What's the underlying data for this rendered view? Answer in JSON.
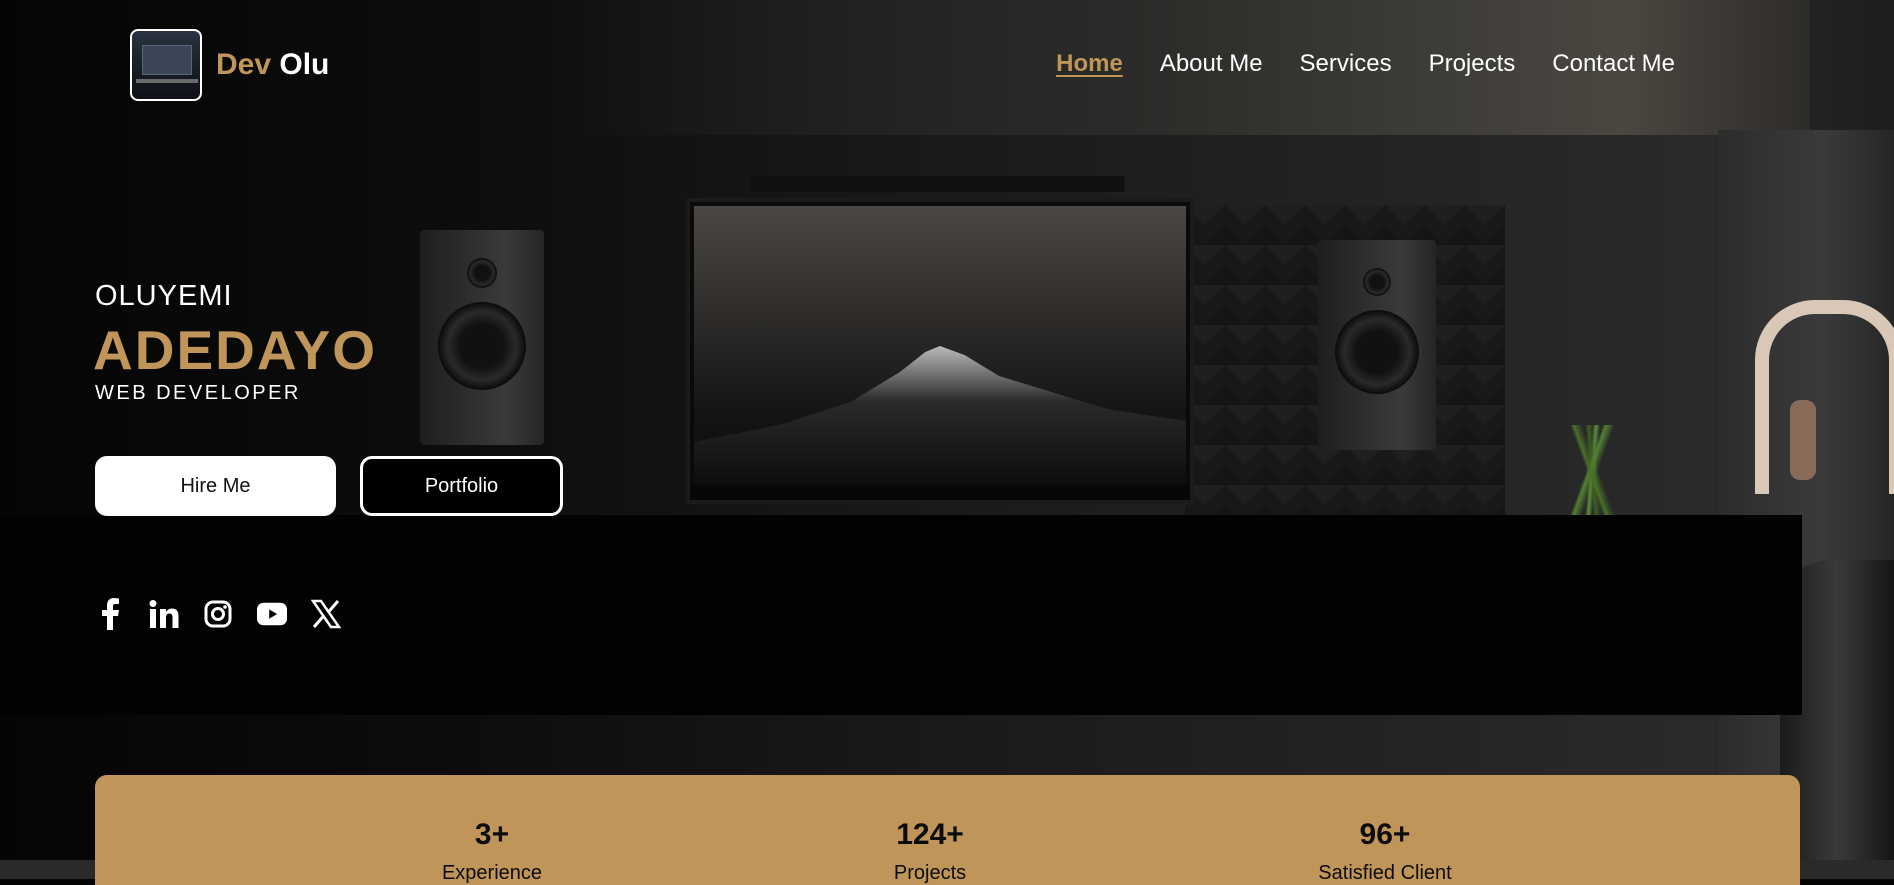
{
  "brand": {
    "first": "Dev",
    "second": "Olu",
    "logo_icon": "desk-setup-logo-icon"
  },
  "nav": {
    "items": [
      "Home",
      "About Me",
      "Services",
      "Projects",
      "Contact Me"
    ],
    "active": "Home"
  },
  "hero": {
    "first_name": "OLUYEMI",
    "last_name": "ADEDAYO",
    "role": "WEB DEVELOPER",
    "hire_label": "Hire Me",
    "portfolio_label": "Portfolio"
  },
  "socials": [
    "facebook-icon",
    "linkedin-icon",
    "instagram-icon",
    "youtube-icon",
    "x-icon"
  ],
  "stats": [
    {
      "value": "3+",
      "label": "Experience"
    },
    {
      "value": "124+",
      "label": "Projects"
    },
    {
      "value": "96+",
      "label": "Satisfied Client"
    }
  ],
  "colors": {
    "accent": "#c0955a",
    "background": "#050505",
    "text": "#ffffff"
  }
}
